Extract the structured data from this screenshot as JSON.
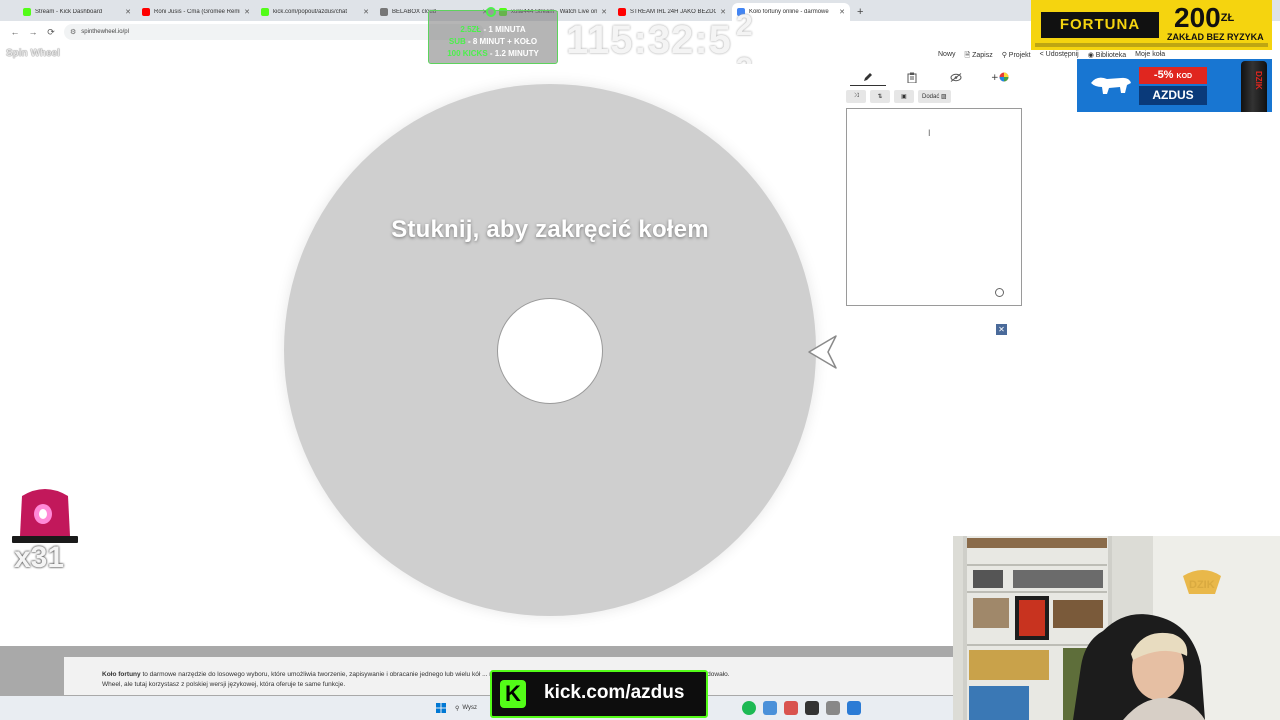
{
  "browser": {
    "tabs": [
      {
        "label": "Stream - Kick Dashboard",
        "color": "#53fc18",
        "active": false
      },
      {
        "label": "Roni Jusis - Ćma (Gromee Remix)",
        "color": "#ff0000",
        "active": false
      },
      {
        "label": "kick.com/popout/azdus/chat",
        "color": "#53fc18",
        "active": false
      },
      {
        "label": "BELABOX cloud",
        "color": "#777777",
        "active": false
      },
      {
        "label": "xulai444 Stream - Watch Live on Kick",
        "color": "#53fc18",
        "active": false
      },
      {
        "label": "STREAM IRL 24H JAKO BEZDOMNY",
        "color": "#ff0000",
        "active": false
      },
      {
        "label": "Koło fortuny online - darmowe",
        "color": "#4285f4",
        "active": true
      }
    ],
    "url": "spinthewheel.io/pl"
  },
  "page": {
    "brand": "Spin Wheel",
    "menu": [
      "Nowy",
      "Zapisz",
      "Projekt",
      "Udostępnij",
      "Biblioteka",
      "Moje koła"
    ],
    "wheel_message": "Stuknij, aby zakręcić kołem",
    "wheel_color": "#cfcfcf"
  },
  "editor": {
    "add_label": "Dodać",
    "tool_icons": [
      "pencil-icon",
      "clipboard-icon",
      "eye-off-icon",
      "add-color-icon"
    ],
    "entries_text": ""
  },
  "footer": {
    "lead": "Koło fortuny",
    "text": " to darmowe narzędzie do losowego wyboru, które umożliwia tworzenie, zapisywanie i obracanie jednego lub wielu kół ... motywy i zmień dźwięki, a następnie pozwól, aby koło fortuny online zadecydowało.",
    "text2": "Wheel, ale tutaj korzystasz z polskiej wersji językowej, która oferuje te same funkcje.",
    "search_label": "Wysz"
  },
  "overlay": {
    "donate_lines": [
      {
        "strong": "2.5ZŁ",
        "rest": " - 1 MINUTA"
      },
      {
        "strong": "SUB",
        "rest": " - 8 MINUT + KOŁO"
      },
      {
        "strong": "100 KICKS",
        "rest": " - 1.2 MINUTY"
      }
    ],
    "timer": "115:32:5",
    "timer_extra": "2",
    "timer_extra2": "3",
    "alert_count": "x31",
    "kick_url": "kick.com/azdus",
    "kick_logo_letter": "K"
  },
  "ads": {
    "fortuna_logo": "FORTUNA",
    "fortuna_amount": "200",
    "fortuna_currency": "ZŁ",
    "fortuna_tagline": "ZAKŁAD BEZ RYZYKA",
    "dzik_discount": "-5%",
    "dzik_kod": "KOD",
    "dzik_code": "AZDUS",
    "dzik_can_label": "DZIK"
  }
}
